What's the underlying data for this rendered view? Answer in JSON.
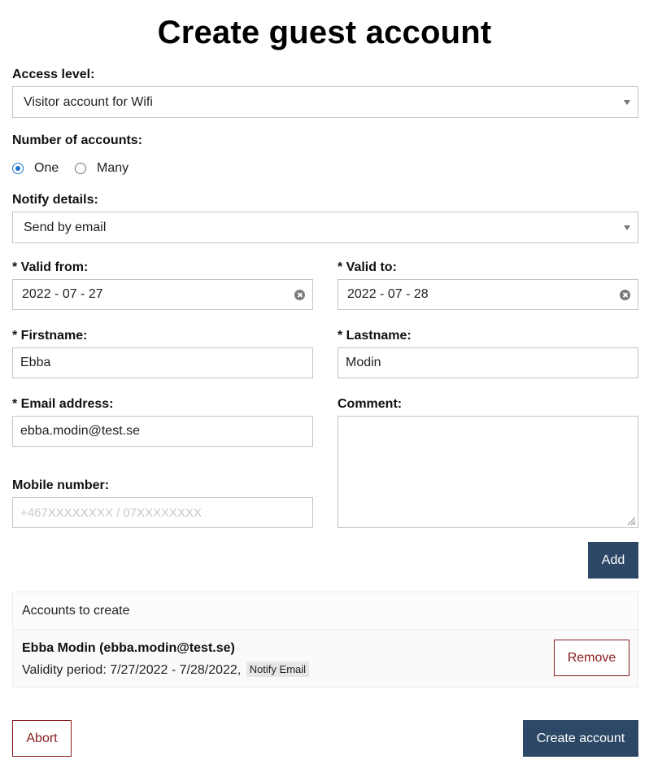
{
  "page": {
    "title": "Create guest account"
  },
  "access_level": {
    "label": "Access level:",
    "value": "Visitor account for Wifi"
  },
  "num_accounts": {
    "label": "Number of accounts:",
    "options": [
      {
        "label": "One",
        "checked": true
      },
      {
        "label": "Many",
        "checked": false
      }
    ]
  },
  "notify": {
    "label": "Notify details:",
    "value": "Send by email"
  },
  "valid_from": {
    "label": "* Valid from:",
    "value": "2022 - 07 - 27"
  },
  "valid_to": {
    "label": "* Valid to:",
    "value": "2022 - 07 - 28"
  },
  "firstname": {
    "label": "* Firstname:",
    "value": "Ebba"
  },
  "lastname": {
    "label": "* Lastname:",
    "value": "Modin"
  },
  "email": {
    "label": "* Email address:",
    "value": "ebba.modin@test.se"
  },
  "comment": {
    "label": "Comment:",
    "value": ""
  },
  "mobile": {
    "label": "Mobile number:",
    "placeholder": "+467XXXXXXXX / 07XXXXXXXX"
  },
  "buttons": {
    "add": "Add",
    "remove": "Remove",
    "abort": "Abort",
    "create": "Create account"
  },
  "accounts": {
    "heading": "Accounts to create",
    "items": [
      {
        "name": "Ebba Modin (ebba.modin@test.se)",
        "validity": "Validity period: 7/27/2022 - 7/28/2022,",
        "tag": "Notify Email"
      }
    ]
  },
  "colors": {
    "primary": "#2c4866",
    "danger": "#8a1b1b",
    "radio_accent": "#1a6fd1"
  },
  "icons": {
    "select_caret": "caret-down-icon",
    "clear": "clear-icon",
    "resize": "resize-handle-icon"
  }
}
